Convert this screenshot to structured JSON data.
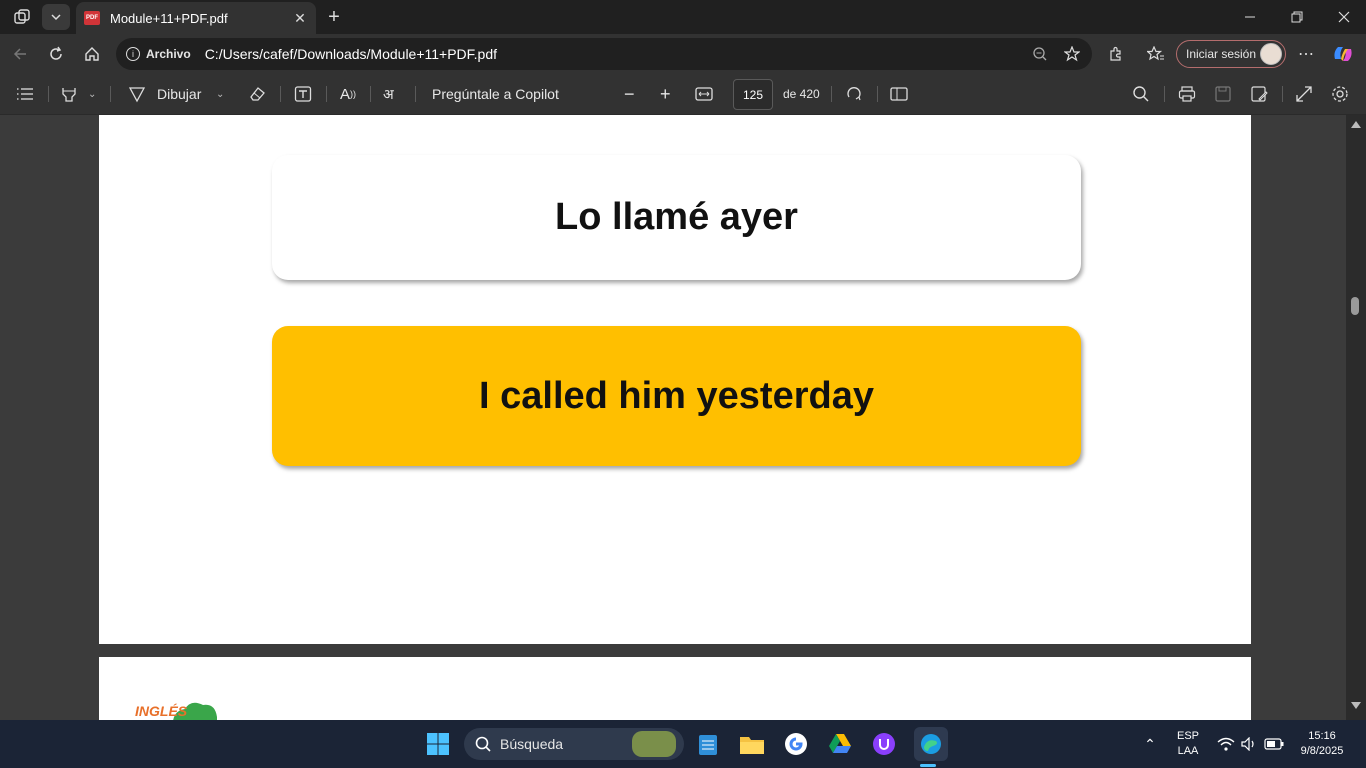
{
  "browser": {
    "tab_title": "Module+11+PDF.pdf",
    "tab_favicon_text": "PDF",
    "address_label": "Archivo",
    "url": "C:/Users/cafef/Downloads/Module+11+PDF.pdf",
    "signin_label": "Iniciar sesión"
  },
  "pdf_toolbar": {
    "draw_label": "Dibujar",
    "copilot_label": "Pregúntale a Copilot",
    "page_number": "125",
    "page_total": "de 420"
  },
  "content": {
    "card1_text": "Lo llamé ayer",
    "card2_text": "I called him yesterday",
    "logo_text": "INGLÉS"
  },
  "taskbar": {
    "search_placeholder": "Búsqueda",
    "lang_top": "ESP",
    "lang_bottom": "LAA",
    "time": "15:16",
    "date": "9/8/2025"
  },
  "colors": {
    "accent_card": "#ffbf00",
    "page_bg": "#ffffff",
    "chrome_bg": "#323232"
  }
}
